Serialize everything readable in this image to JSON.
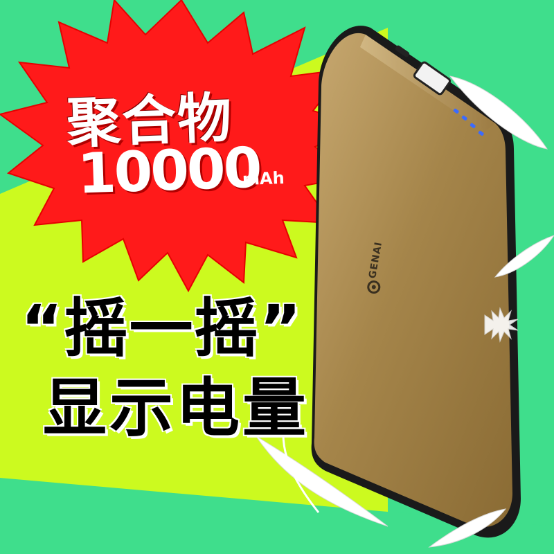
{
  "promo": {
    "material": "聚合物",
    "capacity": "10000",
    "capacity_unit": "mAh",
    "feature_line1": "“摇一摇”",
    "feature_line2": "显示电量"
  },
  "product": {
    "brand_logo": "GENAI"
  },
  "colors": {
    "background_green": "#3fde8c",
    "accent_lime": "#ccfa1f",
    "burst_red": "#ff1a1a",
    "device_gold": "#a5854a",
    "led_blue": "#3b6bff"
  },
  "icons": [
    "starburst-badge-icon",
    "power-bank-image",
    "feather-icon",
    "led-indicator-icon",
    "brand-logo-icon"
  ]
}
